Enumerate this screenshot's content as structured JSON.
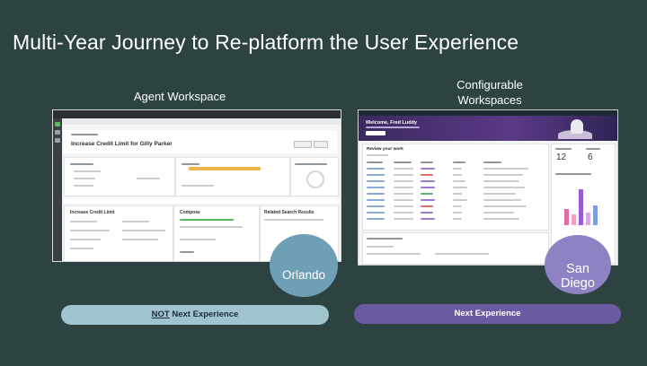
{
  "slide": {
    "title": "Multi-Year Journey to Re-platform the User Experience"
  },
  "left": {
    "caption": "Agent Workspace",
    "screenshot": {
      "record_title": "Increase Credit Limit for Gilly Parker",
      "panel_label": "Increase Credit Limit",
      "compose_label": "Compose",
      "related_label": "Related Search Results"
    },
    "badge": "Orlando",
    "pill": {
      "not": "NOT",
      "rest": " Next Experience"
    }
  },
  "right": {
    "caption_line1": "Configurable",
    "caption_line2": "Workspaces",
    "screenshot": {
      "welcome": "Welcome, Fred Luddy",
      "review_label": "Review your work",
      "metric1": "12",
      "metric2": "6"
    },
    "badge_line1": "San",
    "badge_line2": "Diego",
    "pill": "Next Experience"
  },
  "colors": {
    "background": "#2c4341",
    "orlando_badge": "#6f9fb5",
    "san_diego_badge": "#8e83c2",
    "left_pill": "#9fc4cf",
    "right_pill": "#6b5aa1"
  }
}
